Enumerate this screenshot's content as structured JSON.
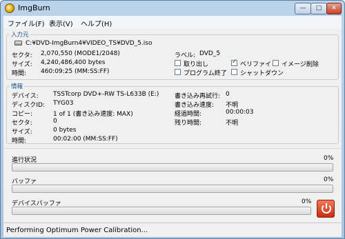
{
  "window": {
    "title": "ImgBurn"
  },
  "title_controls": {
    "minimize": "—",
    "maximize": "□",
    "close": "✕"
  },
  "menu": {
    "items": [
      "ファイル(F)",
      "表示(V)",
      "ヘルプ(H)"
    ]
  },
  "source": {
    "legend": "入力元",
    "path": "C:¥DVD-ImgBurn4¥VIDEO_TS¥DVD_5.iso",
    "rows": [
      {
        "label": "セクタ:",
        "value": "2,070,550 (MODE1/2048)"
      },
      {
        "label": "サイズ:",
        "value": "4,240,486,400 bytes"
      },
      {
        "label": "時間:",
        "value": "460:09:25 (MM:SS:FF)"
      }
    ],
    "volume_label_key": "ラベル:",
    "volume_label_value": "DVD_5",
    "options": [
      {
        "label": "取り出し",
        "checked": false
      },
      {
        "label": "ベリファイ",
        "checked": true
      },
      {
        "label": "イメージ削除",
        "checked": false
      },
      {
        "label": "プログラム終了",
        "checked": false
      },
      {
        "label": "シャットダウン",
        "checked": false
      }
    ]
  },
  "info": {
    "legend": "情報",
    "left_rows": [
      {
        "label": "デバイス:",
        "value": "TSSTcorp DVD+-RW TS-L633B (E:)"
      },
      {
        "label": "ディスクID:",
        "value": "TYG03"
      },
      {
        "label": "コピー:",
        "value": "1 of 1 (書き込み速度: MAX)"
      },
      {
        "label": "セクタ:",
        "value": "0"
      },
      {
        "label": "サイズ:",
        "value": "0 bytes"
      },
      {
        "label": "時間:",
        "value": "00:02:00 (MM:SS:FF)"
      }
    ],
    "right_rows": [
      {
        "label": "書き込み再試行:",
        "value": "0"
      },
      {
        "label": "書き込み速度:",
        "value": "不明"
      },
      {
        "label": "経過時間:",
        "value": "00:00:03"
      },
      {
        "label": "残り時間:",
        "value": "不明"
      }
    ]
  },
  "progress": {
    "overall_label": "進行状況",
    "overall_percent_text": "0%",
    "overall_fraction": 0,
    "buffer_label": "バッファ",
    "buffer_percent_text": "0%",
    "buffer_fraction": 0,
    "device_buffer_label": "デバイスバッファ",
    "device_buffer_percent_text": "0%",
    "device_buffer_fraction": 0
  },
  "abort_button": {
    "icon": "power-icon"
  },
  "status": {
    "text": "Performing Optimum Power Calibration..."
  },
  "colors": {
    "accent": "#1a4a8a",
    "abort": "#c62d12",
    "progress": "#3cb034"
  }
}
